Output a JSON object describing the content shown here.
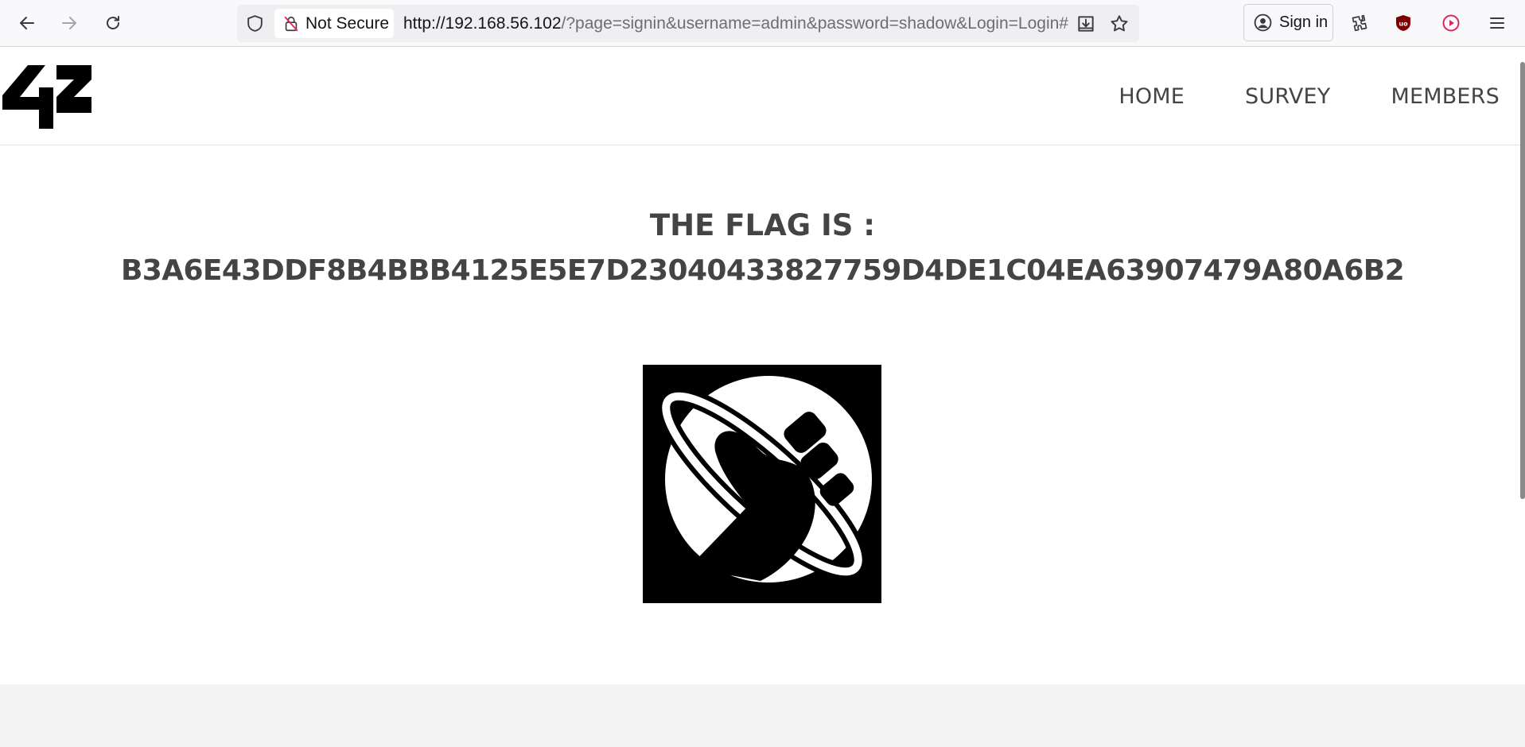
{
  "browser": {
    "security_label": "Not Secure",
    "url_host": "http://192.168.56.102",
    "url_rest": "/?page=signin&username=admin&password=shadow&Login=Login#",
    "sign_in_label": "Sign in",
    "icons": [
      "back-icon",
      "forward-icon",
      "reload-icon",
      "tracking-shield-icon",
      "insecure-lock-icon",
      "download-icon",
      "bookmark-star-icon",
      "account-icon",
      "extensions-icon",
      "ublock-icon",
      "media-play-icon",
      "menu-icon"
    ]
  },
  "site": {
    "logo_text": "42",
    "nav": [
      "HOME",
      "SURVEY",
      "MEMBERS"
    ],
    "flag_title": "THE FLAG IS :",
    "flag_value": "B3A6E43DDF8B4BBB4125E5E7D23040433827759D4DE1C04EA63907479A80A6B2"
  },
  "colors": {
    "chrome_bg": "#f9f9fb",
    "url_bg": "#efeff2",
    "text_dark": "#444444",
    "ublock_red": "#800000",
    "play_red": "#e0245e",
    "footer_bg": "#f4f4f4"
  }
}
